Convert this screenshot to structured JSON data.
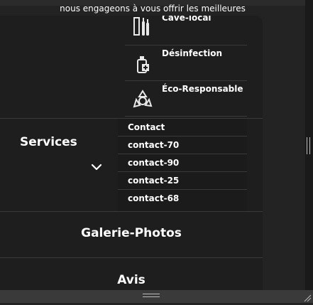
{
  "banner": {
    "text": "nous engageons à vous offrir les meilleures"
  },
  "submenu_products": [
    {
      "label": "Cave-local",
      "icon": "wine-rack-icon"
    },
    {
      "label": "Désinfection",
      "icon": "disinfection-spray-icon"
    },
    {
      "label": "Éco-Responsable",
      "icon": "eco-recycle-icon"
    }
  ],
  "services": {
    "label": "Services",
    "icon": "chevron-down-icon"
  },
  "contacts": [
    {
      "label": "Contact"
    },
    {
      "label": "contact-70"
    },
    {
      "label": "contact-90"
    },
    {
      "label": "contact-25"
    },
    {
      "label": "contact-68"
    }
  ],
  "nav": {
    "gallery": "Galerie-Photos",
    "reviews": "Avis"
  },
  "colors": {
    "background": "#232323",
    "panel": "#1e1e1e",
    "text": "#ffffff",
    "divider": "#3a3a3a"
  }
}
